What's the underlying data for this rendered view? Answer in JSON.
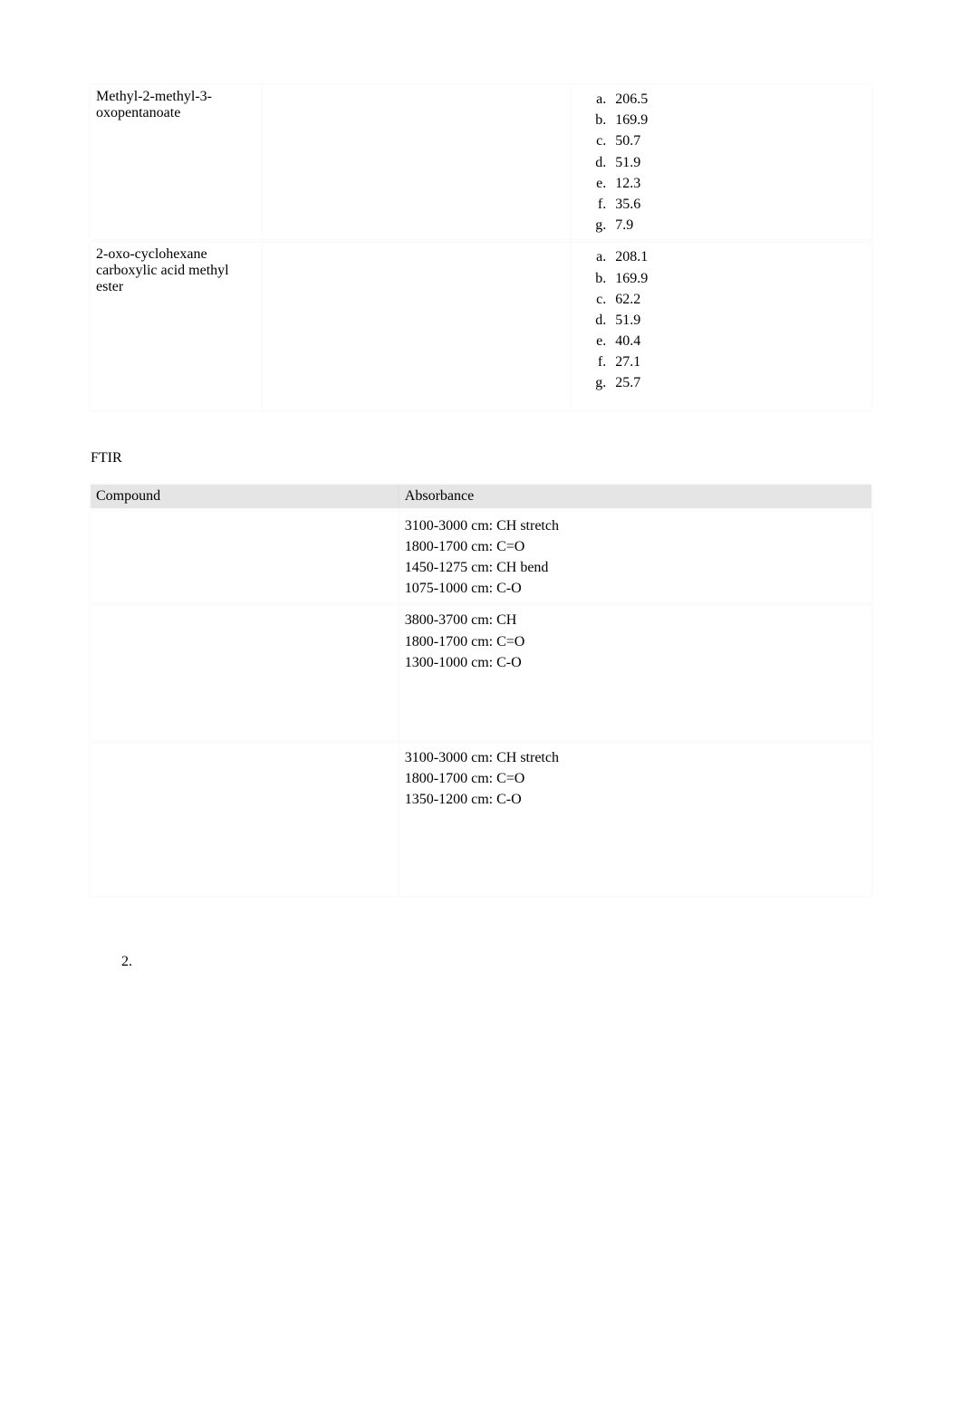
{
  "table1": {
    "rows": [
      {
        "compound": "Methyl-2-methyl-3-oxopentanoate",
        "values": [
          "206.5",
          "169.9",
          "50.7",
          "51.9",
          "12.3",
          "35.6",
          "7.9"
        ]
      },
      {
        "compound": "2-oxo-cyclohexane carboxylic acid methyl ester",
        "values": [
          "208.1",
          "169.9",
          "62.2",
          "51.9",
          "40.4",
          "27.1",
          "25.7"
        ]
      }
    ]
  },
  "section2": {
    "title": "FTIR",
    "headers": {
      "col1": "Compound",
      "col2": "Absorbance"
    },
    "rows": [
      {
        "compound": "",
        "absorbance": [
          "3100-3000 cm: CH stretch",
          "1800-1700 cm: C=O",
          "1450-1275 cm: CH bend",
          "1075-1000 cm: C-O"
        ]
      },
      {
        "compound": "",
        "absorbance": [
          "3800-3700 cm: CH",
          "1800-1700 cm: C=O",
          "1300-1000 cm: C-O"
        ]
      },
      {
        "compound": "",
        "absorbance": [
          "3100-3000 cm: CH stretch",
          "1800-1700 cm: C=O",
          "1350-1200 cm: C-O"
        ]
      }
    ]
  },
  "list": {
    "item": "2."
  }
}
